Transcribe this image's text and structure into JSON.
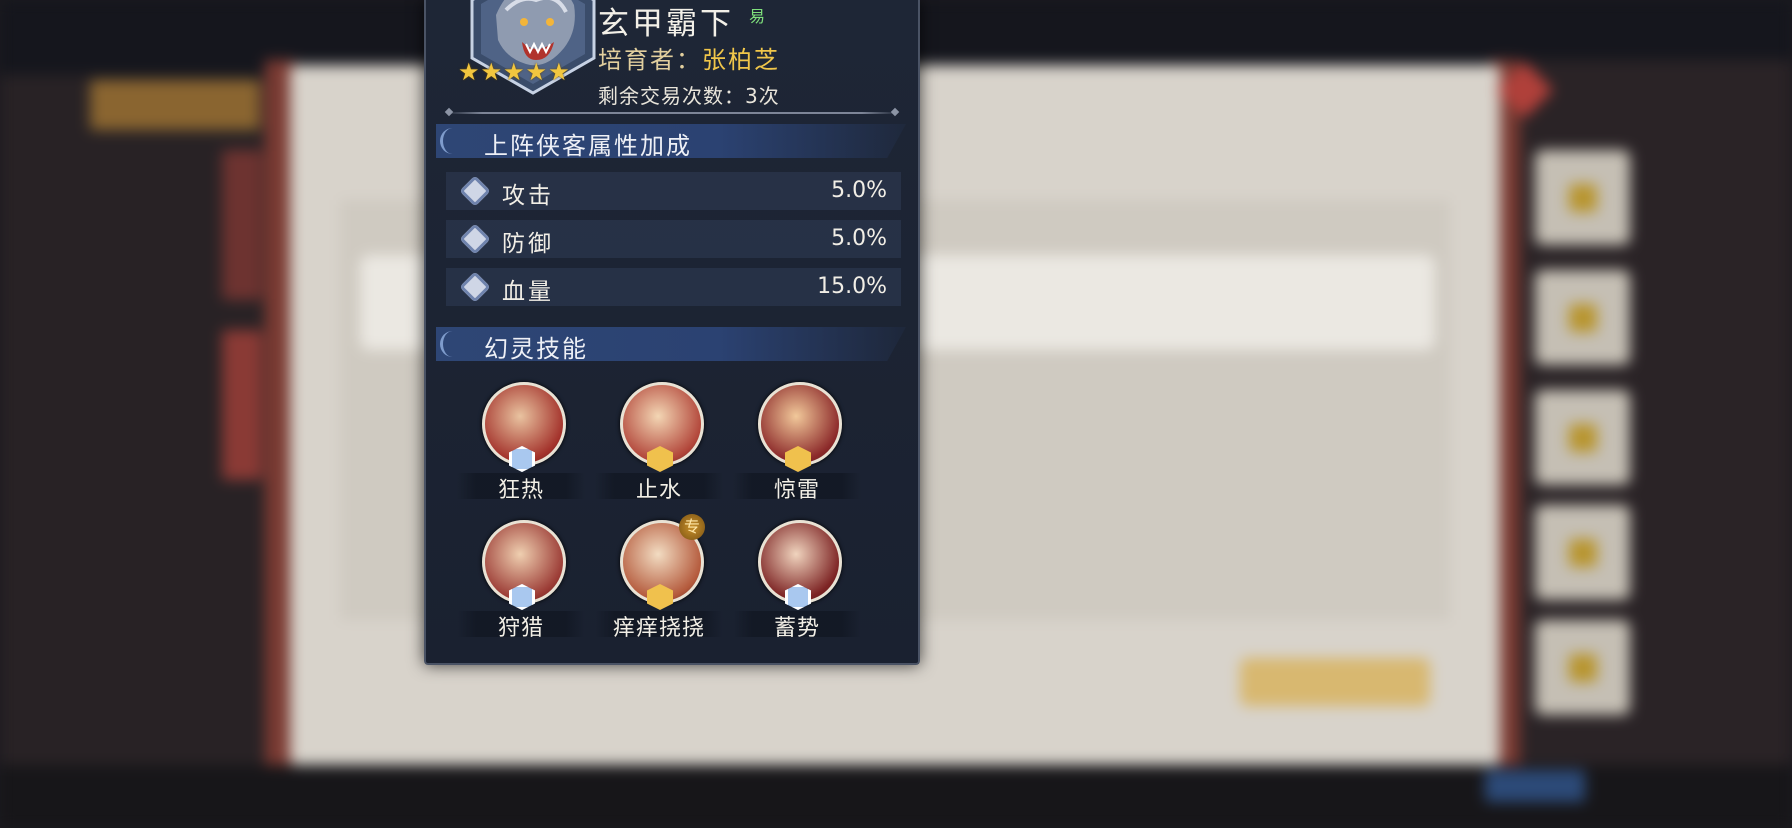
{
  "pet": {
    "name": "玄甲霸下",
    "trade_badge": "易",
    "stars": 5,
    "breeder_label": "培育者：",
    "breeder_name": "张柏芝",
    "trades_left": "剩余交易次数：3次"
  },
  "bonus_section": {
    "title": "上阵侠客属性加成",
    "stats": [
      {
        "name": "攻击",
        "value": "5.0%",
        "icon": "attack-icon"
      },
      {
        "name": "防御",
        "value": "5.0%",
        "icon": "shield-icon"
      },
      {
        "name": "血量",
        "value": "15.0%",
        "icon": "heart-icon"
      }
    ]
  },
  "skill_section": {
    "title": "幻灵技能",
    "skills": [
      {
        "name": "狂热",
        "badge": "blue",
        "colors": [
          "#e9c3a0",
          "#a3322b"
        ]
      },
      {
        "name": "止水",
        "badge": "gold",
        "colors": [
          "#f3d6b4",
          "#b2463a"
        ]
      },
      {
        "name": "惊雷",
        "badge": "gold",
        "colors": [
          "#f1c89a",
          "#8c2a2a"
        ]
      },
      {
        "name": "狩猎",
        "badge": "blue",
        "colors": [
          "#efcfb0",
          "#9b3b35"
        ]
      },
      {
        "name": "痒痒挠挠",
        "badge": "gold",
        "exclusive": "专",
        "colors": [
          "#f2dcc2",
          "#b45a3c"
        ]
      },
      {
        "name": "蓄势",
        "badge": "blue",
        "colors": [
          "#f0d4be",
          "#7d2424"
        ]
      }
    ]
  }
}
